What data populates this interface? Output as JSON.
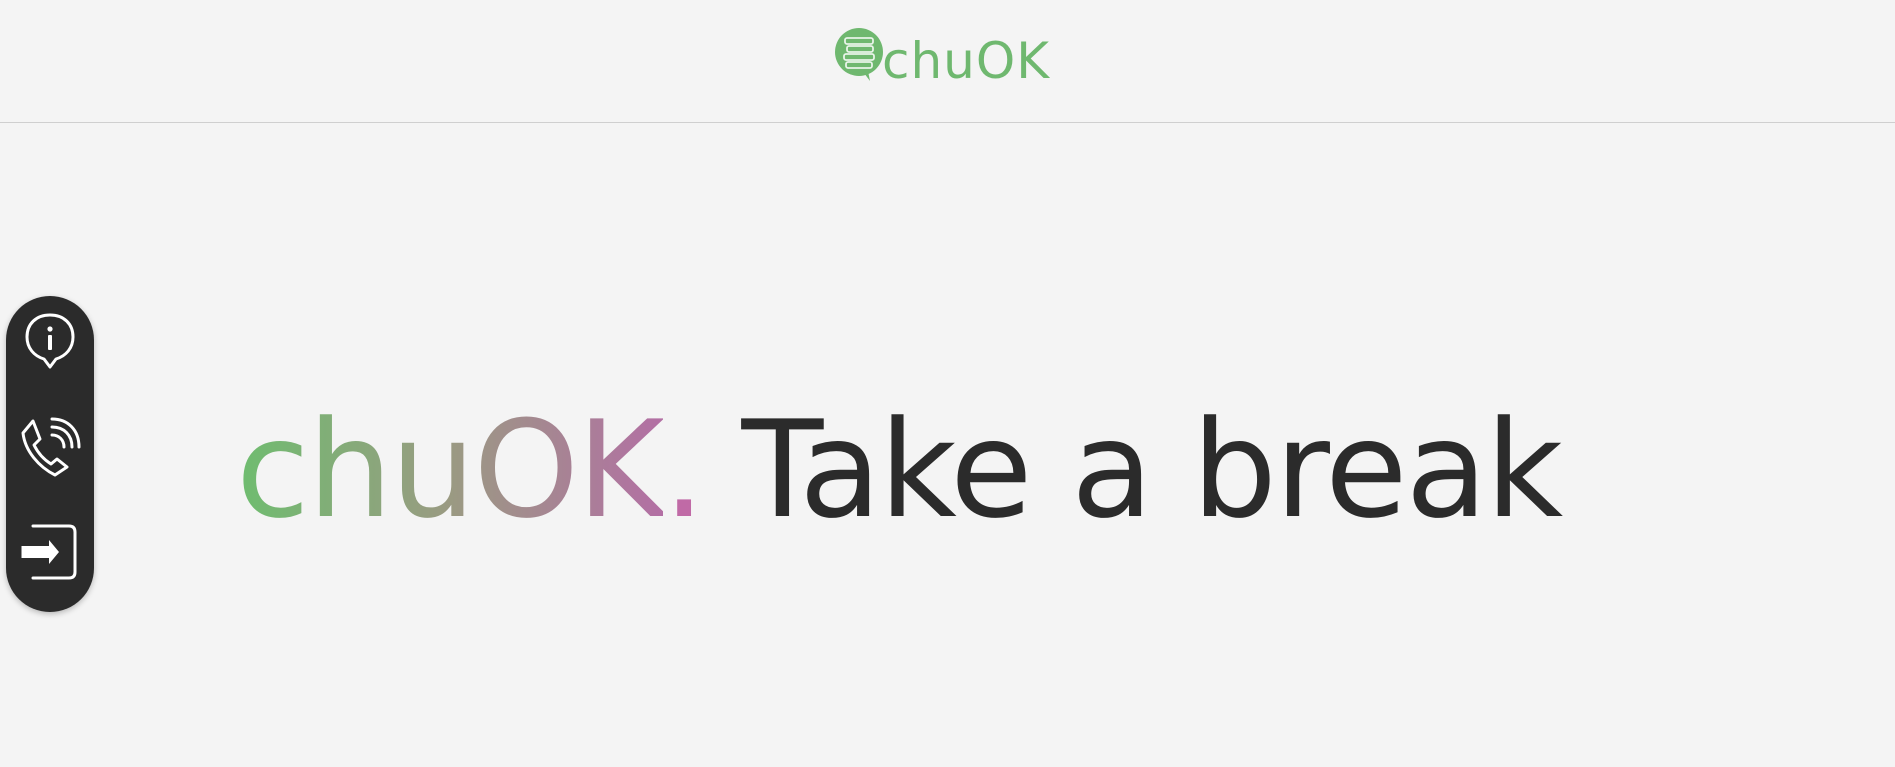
{
  "header": {
    "logo_text": "chuOK"
  },
  "sidebar": {
    "items": [
      {
        "icon": "info-icon",
        "label": ""
      },
      {
        "icon": "phone-icon",
        "label": ""
      },
      {
        "icon": "logout-icon",
        "label": ""
      }
    ]
  },
  "hero": {
    "brand": "chuOK",
    "dot": ".",
    "tagline": "Take a break"
  },
  "colors": {
    "background": "#f4f4f4",
    "brand_green": "#6fb86f",
    "brand_pink": "#b36fa4",
    "dark": "#2b2b2b"
  }
}
